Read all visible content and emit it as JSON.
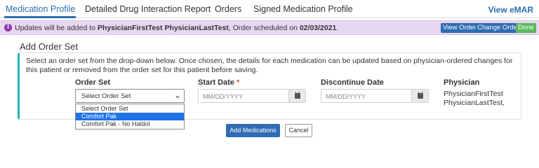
{
  "tabs": [
    {
      "label": "Medication Profile"
    },
    {
      "label": "Detailed Drug Interaction Report"
    },
    {
      "label": "Orders"
    },
    {
      "label": "Signed Medication Profile"
    }
  ],
  "view_emar": "View eMAR",
  "banner": {
    "icon": "info-icon",
    "prefix": "Updates will be added to ",
    "physician": "PhysicianFirstTest PhysicianLastTest",
    "middle": ", Order scheduled on ",
    "date": "02/03/2021",
    "suffix": ".",
    "buttons": {
      "view_order": "View Order",
      "change_order": "Change Order",
      "done": "Done"
    }
  },
  "card": {
    "title": "Add Order Set",
    "description": "Select an order set from the drop-down below. Once chosen, the details for each medication can be updated based on physician-ordered changes for this patient or removed from the order set for this patient before saving.",
    "order_set_label": "Order Set",
    "order_set_value": "Select Order Set",
    "dropdown_options": [
      "Select Order Set",
      "Comfort Pak",
      "Comfort Pak - No Haldol"
    ],
    "highlighted_option_index": 1,
    "start_date_label": "Start Date",
    "required_mark": "*",
    "start_date_placeholder": "MM/DD/YYYY",
    "discontinue_label": "Discontinue Date",
    "discontinue_placeholder": "MM/DD/YYYY",
    "physician_label": "Physician",
    "physician_first": "PhysicianFirstTest",
    "physician_last": "PhysicianLastTest,"
  },
  "actions": {
    "add": "Add Medications",
    "cancel": "Cancel"
  },
  "colors": {
    "accent": "#2a6fb0",
    "banner_bg": "#e8d7f1",
    "card_border": "#2bb3b3",
    "primary_button": "#2f6cb3",
    "done_button": "#5cb85c",
    "highlight": "#1e73e8"
  }
}
